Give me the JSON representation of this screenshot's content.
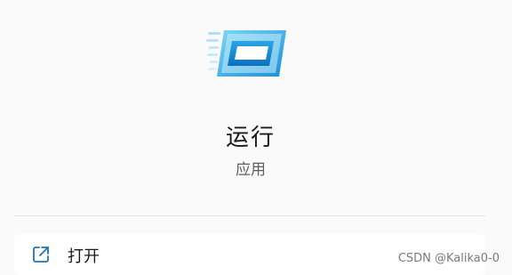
{
  "app": {
    "name": "运行",
    "type": "应用",
    "icon": "run-dialog-icon"
  },
  "actions": [
    {
      "label": "打开",
      "icon": "open-external-icon"
    }
  ],
  "watermark": "CSDN @Kalika0-0",
  "colors": {
    "accent": "#1f8fd6",
    "icon_light": "#7fd0f5",
    "text_primary": "#1a1a1a",
    "text_secondary": "#5f5f5f"
  }
}
